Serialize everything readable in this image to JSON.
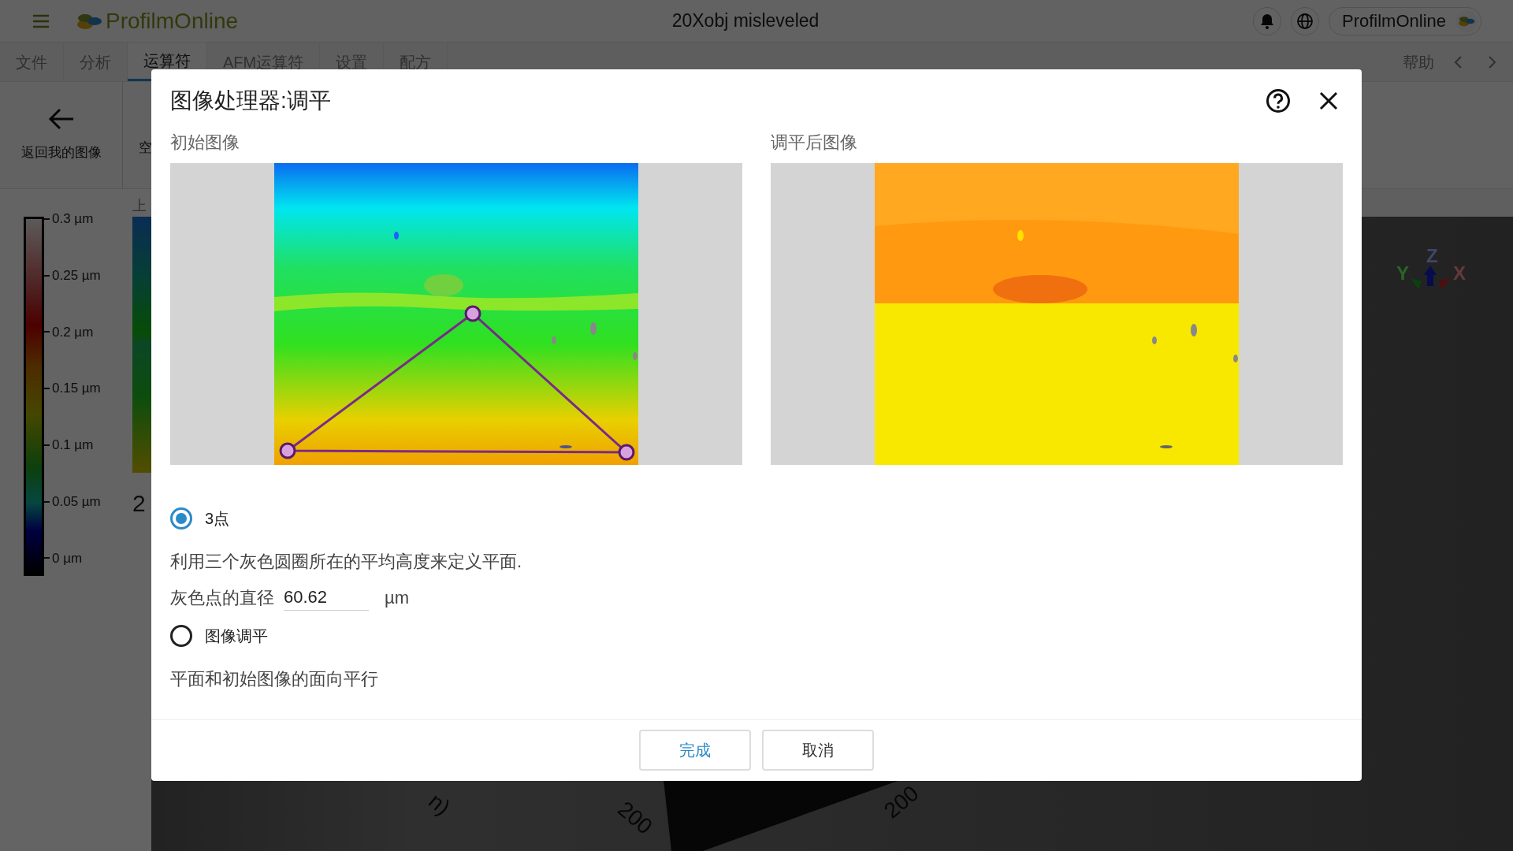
{
  "app_bar": {
    "logo_text": "ProfilmOnline",
    "document_title": "20Xobj misleveled",
    "user_button": "ProfilmOnline"
  },
  "tabs": [
    {
      "label": "文件",
      "selected": false
    },
    {
      "label": "分析",
      "selected": false
    },
    {
      "label": "运算符",
      "selected": true
    },
    {
      "label": "AFM运算符",
      "selected": false
    },
    {
      "label": "设置",
      "selected": false
    },
    {
      "label": "配方",
      "selected": false
    }
  ],
  "help_tab": "帮助",
  "toolbar": {
    "items": [
      {
        "label": "返回我的图像",
        "kind": "back"
      },
      {
        "label": "空",
        "kind": "partial"
      }
    ]
  },
  "colorbar": {
    "ticks": [
      "0.3 µm",
      "0.25 µm",
      "0.2 µm",
      "0.15 µm",
      "0.1 µm",
      "0.05 µm",
      "0 µm"
    ]
  },
  "side_panel": {
    "label": "上",
    "heading": "2"
  },
  "viewer": {
    "axis_labels": [
      "Z",
      "Y",
      "X"
    ],
    "tick_labels": [
      "n)",
      "200",
      "200"
    ]
  },
  "dialog": {
    "title": "图像处理器:调平",
    "panels": [
      {
        "label": "初始图像",
        "kind": "original"
      },
      {
        "label": "调平后图像",
        "kind": "leveled"
      }
    ],
    "options": [
      {
        "label": "3点",
        "selected": true,
        "description": "利用三个灰色圆圈所在的平均高度来定义平面.",
        "field": {
          "label": "灰色点的直径",
          "value": "60.62",
          "unit": "µm"
        }
      },
      {
        "label": "图像调平",
        "selected": false,
        "description": "平面和初始图像的面向平行"
      }
    ],
    "buttons": [
      {
        "label": "完成",
        "kind": "primary"
      },
      {
        "label": "取消",
        "kind": "secondary"
      }
    ]
  }
}
